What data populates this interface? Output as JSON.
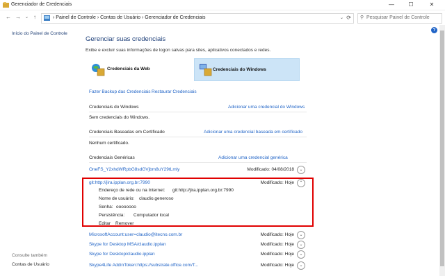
{
  "window": {
    "title": "Gerenciador de Credenciais",
    "minimize": "—",
    "maximize": "☐",
    "close": "✕"
  },
  "address": {
    "back": "←",
    "forward": "→",
    "up": "↑",
    "crumbs": "›  Painel de Controle  ›  Contas de Usuário  ›  Gerenciador de Credenciais",
    "search_placeholder": "Pesquisar Painel de Controle"
  },
  "sidebar": {
    "home_link": "Início do Painel de Controle",
    "see_also": "Consulte também",
    "user_accounts": "Contas de Usuário"
  },
  "main": {
    "title": "Gerenciar suas credenciais",
    "description": "Exibe e excluir suas informações de logon salvas para sites, aplicativos conectados e redes.",
    "tab_web": "Credenciais da Web",
    "tab_windows": "Credenciais do Windows",
    "backup_link": "Fazer Backup das Credenciais",
    "restore_link": "Restaurar Credenciais",
    "windows_section": {
      "heading": "Credenciais do Windows",
      "add_link": "Adicionar uma credencial do Windows",
      "empty": "Sem credenciais do Windows."
    },
    "cert_section": {
      "heading": "Credenciais Baseadas em Certificado",
      "add_link": "Adicionar uma credencial baseada em certificado",
      "empty": "Nenhum certificado."
    },
    "generic_section": {
      "heading": "Credenciais Genéricas",
      "add_link": "Adicionar uma credencial genérica"
    }
  },
  "credentials": [
    {
      "name": "OneFS_Y2xhdWRpbG8sdGVjbm8uY29tLmly",
      "modified": "Modificado:  04/08/2018"
    },
    {
      "name": "MicrosoftAccount:user=claudio@itecno.com.br",
      "modified": "Modificado:  Hoje"
    },
    {
      "name": "Skype for Desktop MSA/claudio.ipplan",
      "modified": "Modificado:  Hoje"
    },
    {
      "name": "Skype for Desktop/claudio.ipplan",
      "modified": "Modificado:  Hoje"
    },
    {
      "name": "Skype4Life AddinToken:https://substrate.office.com/T...",
      "modified": "Modificado:  Hoje"
    }
  ],
  "expanded": {
    "name": "git:http://jira.ipplan.org.br:7990",
    "modified": "Modificado:  Hoje",
    "address_label": "Endereço de rede ou na Internet:",
    "address_value": "git:http://jira.ipplan.org.br:7990",
    "user_label": "Nome de usuário:",
    "user_value": "claudio.generoso",
    "password_label": "Senha:",
    "password_value": "oooooooo",
    "persistence_label": "Persistência:",
    "persistence_value": "Computador local",
    "edit": "Editar",
    "remove": "Remover"
  },
  "icons": {
    "chevron_down": "⌄",
    "chevron_up": "⌃",
    "help": "?"
  },
  "colors": {
    "accent": "#1f63c6",
    "title": "#1e3f79",
    "highlight": "#e00000",
    "selected_tab": "#cce4f7"
  }
}
